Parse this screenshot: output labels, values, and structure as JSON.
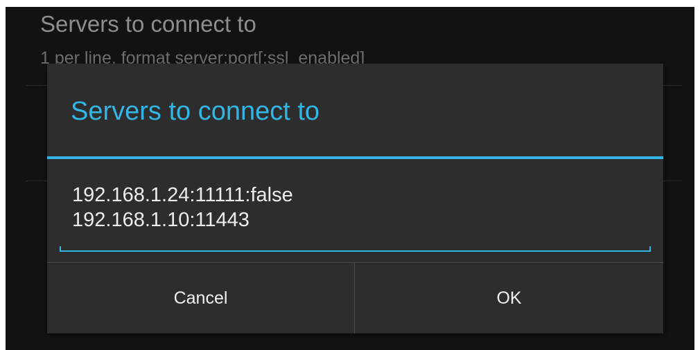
{
  "background_pref": {
    "title": "Servers to connect to",
    "summary": "1 per line, format server:port[:ssl_enabled]"
  },
  "dialog": {
    "title": "Servers to connect to",
    "field_lines": [
      "192.168.1.24:11111:false",
      "192.168.1.10:11443"
    ],
    "cancel_label": "Cancel",
    "ok_label": "OK"
  },
  "colors": {
    "accent": "#33b5e5",
    "dialog_bg": "#2d2d2d",
    "screen_bg": "#121212"
  }
}
